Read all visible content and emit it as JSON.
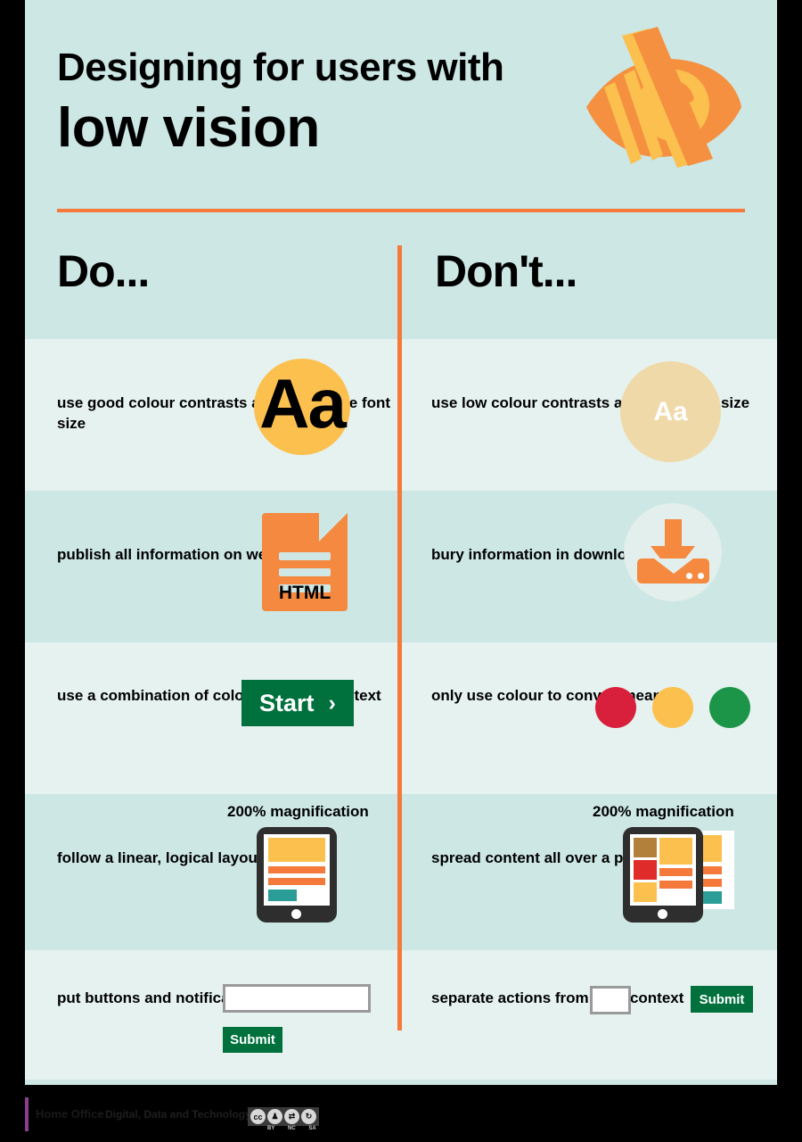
{
  "poster": {
    "title_line1": "Designing for users with",
    "title_line2": "low vision",
    "hero_icon": "low-vision-eye-icon"
  },
  "columns": {
    "do_heading": "Do...",
    "dont_heading": "Don't..."
  },
  "rows": [
    {
      "do": {
        "text": "use good colour contrasts and a readable font size",
        "graphic": "aa-circle-high-contrast",
        "glyph": "Aa"
      },
      "dont": {
        "text": "use low colour contrasts and small font size",
        "graphic": "aa-circle-low-contrast",
        "glyph": "Aa"
      }
    },
    {
      "do": {
        "text": "publish all information on web pages",
        "graphic": "html-document-icon",
        "label": "HTML"
      },
      "dont": {
        "text": "bury information in downloads",
        "graphic": "download-icon"
      }
    },
    {
      "do": {
        "text": "use a combination of colour, shapes and text",
        "graphic": "start-button",
        "button_label": "Start",
        "chevron": "›"
      },
      "dont": {
        "text": "only use colour to convey meaning",
        "graphic": "colour-only-dots"
      }
    },
    {
      "do": {
        "text": "follow a linear, logical layout",
        "graphic": "tablet-linear-layout",
        "magnification_label": "200% magnification"
      },
      "dont": {
        "text": "spread content all over a page",
        "graphic": "tablet-spread-layout",
        "magnification_label": "200% magnification"
      }
    },
    {
      "do": {
        "text": "put buttons and notifications in context",
        "graphic": "form-in-context",
        "input_value": "",
        "input_placeholder": "",
        "submit_label": "Submit"
      },
      "dont": {
        "text": "separate actions from their context",
        "graphic": "form-separated",
        "input_value": "",
        "input_placeholder": "",
        "submit_label": "Submit"
      }
    }
  ],
  "colours": {
    "dot_red": "#d8203c",
    "dot_amber": "#fcc04f",
    "dot_green": "#1c9548",
    "accent_orange": "#f4793b",
    "brand_green": "#00703c",
    "band_light": "#e5f2f0",
    "band_dark": "#cce7e4"
  },
  "footer": {
    "org": "Home Office",
    "team": "Digital, Data and Technology",
    "licence": [
      "cc",
      "BY",
      "NC",
      "SA"
    ],
    "licence_marks": [
      "CC",
      "ⓘ",
      "⇄",
      "↻"
    ]
  }
}
